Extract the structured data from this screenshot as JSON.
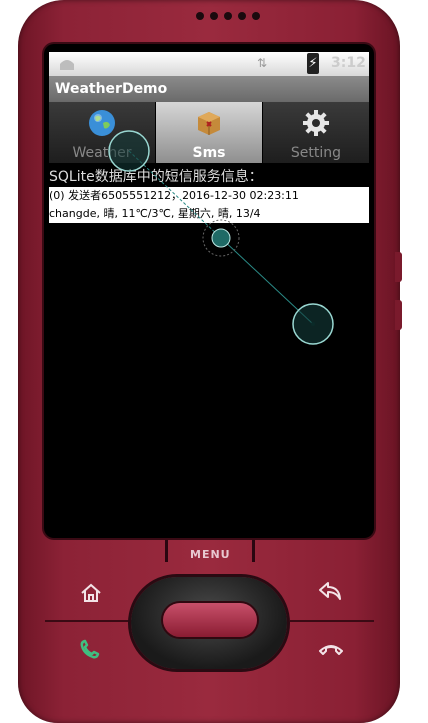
{
  "status_bar": {
    "time": "3:12",
    "app_icon": "android-icon",
    "signal_icon": "signal-icon",
    "battery_icon": "battery-charging-icon"
  },
  "app": {
    "title": "WeatherDemo"
  },
  "tabs": [
    {
      "label": "Weather",
      "icon": "globe-icon",
      "active": false
    },
    {
      "label": "Sms",
      "icon": "box-icon",
      "active": true
    },
    {
      "label": "Setting",
      "icon": "gear-icon",
      "active": false
    }
  ],
  "content": {
    "title": "SQLite数据库中的短信服务信息：",
    "sms": [
      "(0) 发送者6505551212，2016-12-30 02:23:11",
      "changde, 晴, 11℃/3℃, 星期六, 晴, 13/4"
    ]
  },
  "hardware": {
    "menu_label": "MENU",
    "home_icon": "home-icon",
    "back_icon": "back-arrow-icon",
    "call_icon": "call-icon",
    "end_call_icon": "end-call-icon"
  },
  "colors": {
    "phone_body": "#9a2a3e",
    "gesture_accent": "#1f6a66"
  }
}
